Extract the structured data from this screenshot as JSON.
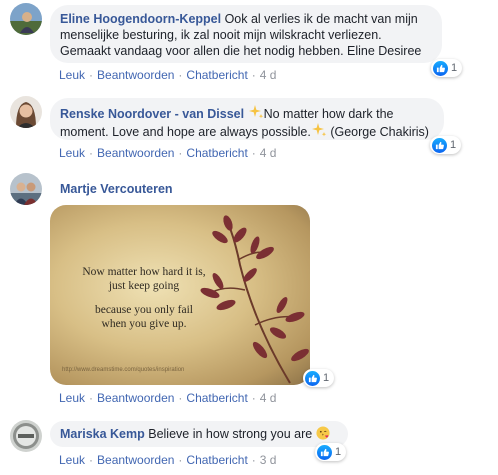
{
  "comments": [
    {
      "author": "Eline Hoogendoorn-Keppel",
      "lines": [
        " Ook al verlies ik de macht van mijn",
        "menselijke besturing, ik zal nooit mijn wilskracht verliezen.",
        "Gemaakt vandaag voor allen die het nodig hebben. Eline Desiree"
      ],
      "like": "Leuk",
      "reply": "Beantwoorden",
      "chat": "Chatbericht",
      "age": "4 d",
      "reactions": "1"
    },
    {
      "author": "Renske Noordover - van Dissel",
      "line1": "No matter how dark the",
      "line2": "moment. Love and hope are always possible.",
      "line2b": " (George Chakiris)",
      "like": "Leuk",
      "reply": "Beantwoorden",
      "chat": "Chatbericht",
      "age": "4 d",
      "reactions": "1"
    },
    {
      "author": "Martje Vercouteren",
      "image_quote": {
        "l1": "Now matter how hard it is,",
        "l2": "just keep going",
        "l3": "because you only fail",
        "l4": "when you give up.",
        "watermark": "http://www.dreamstime.com/quotes/inspiration"
      },
      "like": "Leuk",
      "reply": "Beantwoorden",
      "chat": "Chatbericht",
      "age": "4 d",
      "reactions": "1"
    },
    {
      "author": "Mariska Kemp",
      "text": " Believe in how strong you are",
      "like": "Leuk",
      "reply": "Beantwoorden",
      "chat": "Chatbericht",
      "age": "3 d",
      "reactions": "1"
    }
  ],
  "separator": "·",
  "icons": {
    "like": "thumbs-up-icon",
    "sparkle": "sparkles-icon",
    "emoji": "kissing-face-icon"
  },
  "colors": {
    "author": "#385898",
    "link": "#4267b2",
    "bubble": "#f2f3f5",
    "like_blue": "#1877f2"
  }
}
